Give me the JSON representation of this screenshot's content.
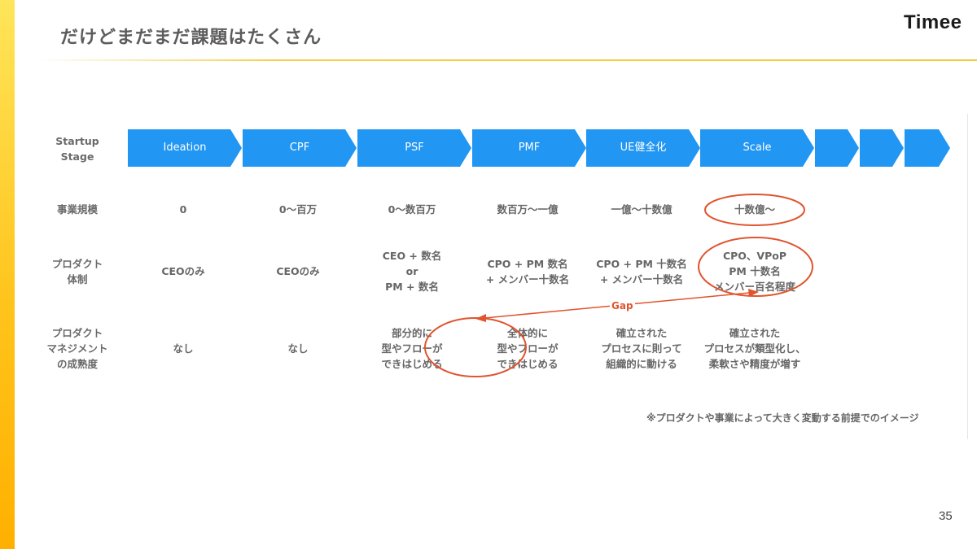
{
  "slide": {
    "title": "だけどまだまだ課題はたくさん",
    "brand": "Timee",
    "page_number": "35",
    "footnote": "※プロダクトや事業によって大きく変動する前提でのイメージ",
    "gap_label": "Gap",
    "accent_color": "#2196f3",
    "highlight_color": "#e0542e",
    "side_bar_color": "#ffc41c"
  },
  "rows": {
    "stage_label": "Startup\nStage",
    "scale_label": "事業規模",
    "product_org_label": "プロダクト\n体制",
    "mgmt_label": "プロダクト\nマネジメント\nの成熟度"
  },
  "stages": [
    "Ideation",
    "CPF",
    "PSF",
    "PMF",
    "UE健全化",
    "Scale",
    "",
    "",
    ""
  ],
  "scale": [
    "0",
    "0〜百万",
    "0〜数百万",
    "数百万〜一億",
    "一億〜十数億",
    "十数億〜"
  ],
  "product_org": [
    "CEOのみ",
    "CEOのみ",
    "CEO + 数名\nor\nPM + 数名",
    "CPO + PM 数名\n+ メンバー十数名",
    "CPO + PM 十数名\n+ メンバー十数名",
    "CPO、VPoP\nPM 十数名\nメンバー百名程度"
  ],
  "maturity": [
    "なし",
    "なし",
    "部分的に\n型やフローが\nできはじめる",
    "全体的に\n型やフローが\nできはじめる",
    "確立された\nプロセスに則って\n組織的に動ける",
    "確立された\nプロセスが類型化し、\n柔軟さや精度が増す"
  ]
}
